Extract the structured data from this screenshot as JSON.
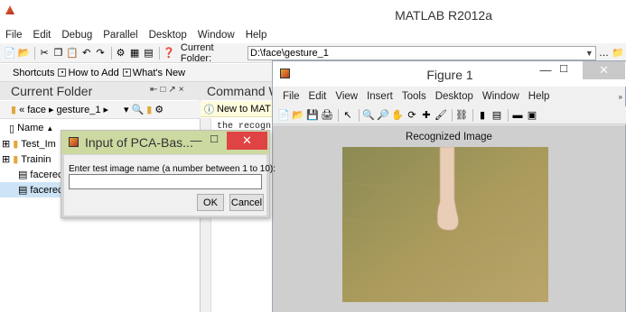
{
  "matlab": {
    "title": "MATLAB  R2012a",
    "menu": [
      "File",
      "Edit",
      "Debug",
      "Parallel",
      "Desktop",
      "Window",
      "Help"
    ],
    "current_folder_label": "Current Folder:",
    "current_folder_path": "D:\\face\\gesture_1",
    "shortcuts": [
      "Shortcuts",
      "How to Add",
      "What's New"
    ]
  },
  "folder_panel": {
    "title": "Current Folder",
    "breadcrumb": [
      "«",
      "face",
      "gesture_1"
    ],
    "column_name": "Name",
    "items": [
      "Test_Im",
      "Trainin",
      "facerec",
      "facerec"
    ]
  },
  "command_window": {
    "title": "Command W",
    "info": "New to MAT",
    "text": "the recogn"
  },
  "figure": {
    "title": "Figure 1",
    "menu": [
      "File",
      "Edit",
      "View",
      "Insert",
      "Tools",
      "Desktop",
      "Window",
      "Help"
    ],
    "image_title": "Recognized Image"
  },
  "dialog": {
    "title": "Input of PCA-Bas...",
    "prompt": "Enter test image name (a number between 1 to 10):",
    "value": "",
    "ok": "OK",
    "cancel": "Cancel"
  }
}
